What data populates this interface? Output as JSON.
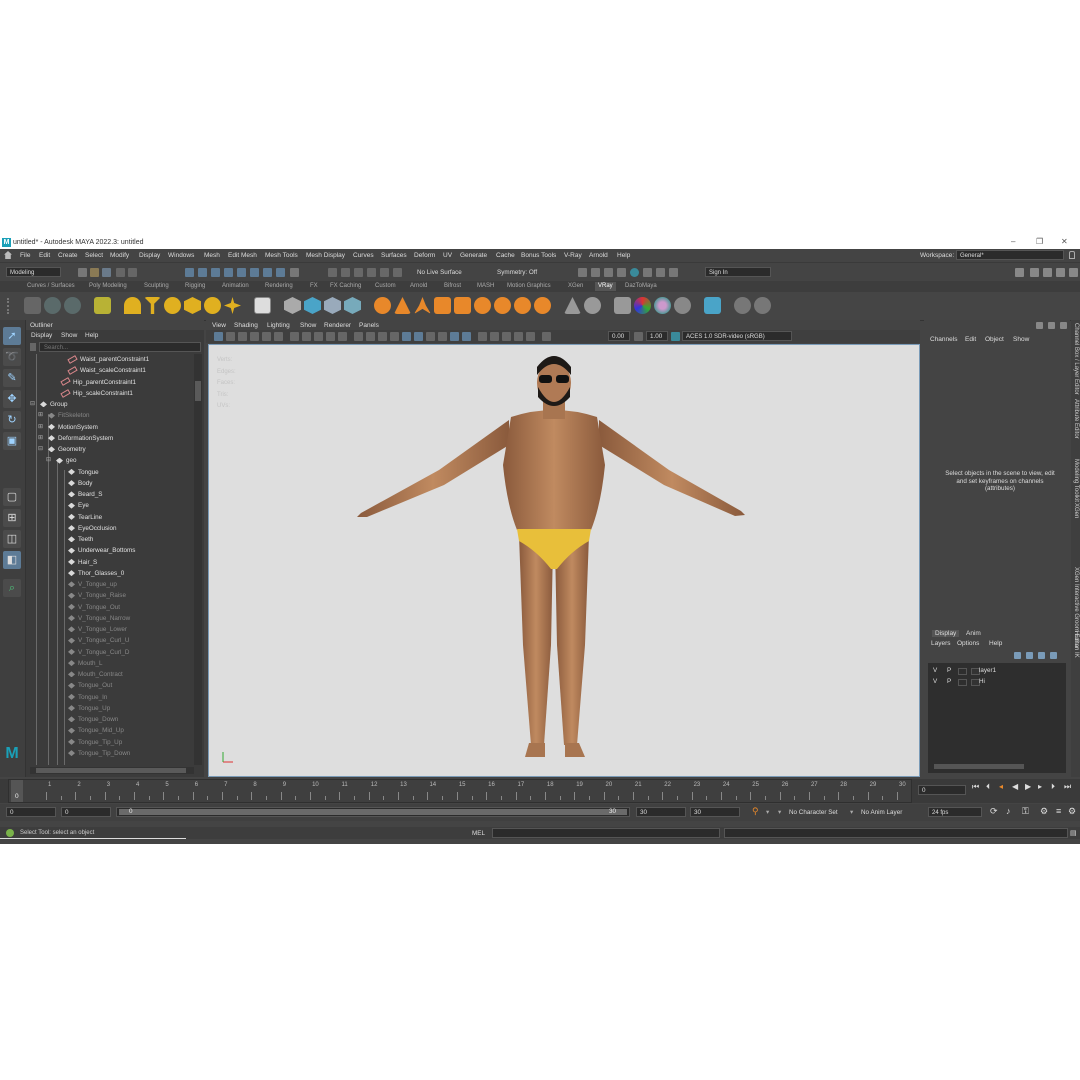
{
  "window": {
    "title": "untitled* - Autodesk MAYA 2022.3: untitled",
    "controls": [
      "–",
      "❐",
      "✕"
    ]
  },
  "menubar": {
    "items": [
      "File",
      "Edit",
      "Create",
      "Select",
      "Modify",
      "Display",
      "Windows",
      "Mesh",
      "Edit Mesh",
      "Mesh Tools",
      "Mesh Display",
      "Curves",
      "Surfaces",
      "Deform",
      "UV",
      "Generate",
      "Cache",
      "Bonus Tools",
      "V-Ray",
      "Arnold",
      "Help"
    ],
    "workspace_label": "Workspace:",
    "workspace_value": "General*"
  },
  "statusline": {
    "mode": "Modeling",
    "live_surface": "No Live Surface",
    "symmetry": "Symmetry: Off",
    "sign_in": "Sign In"
  },
  "shelf": {
    "tabs": [
      "Curves / Surfaces",
      "Poly Modeling",
      "Sculpting",
      "Rigging",
      "Animation",
      "Rendering",
      "FX",
      "FX Caching",
      "Custom",
      "Arnold",
      "Bifrost",
      "MASH",
      "Motion Graphics",
      "XGen",
      "VRay",
      "DazToMaya"
    ],
    "active_tab": "VRay"
  },
  "outliner": {
    "title": "Outliner",
    "menu": [
      "Display",
      "Show",
      "Help"
    ],
    "search_placeholder": "Search...",
    "rows": [
      {
        "label": "Waist_parentConstraint1",
        "icon": "constraint-icon",
        "dim": false
      },
      {
        "label": "Waist_scaleConstraint1",
        "icon": "constraint-icon",
        "dim": false
      },
      {
        "label": "Hip_parentConstraint1",
        "icon": "constraint-icon",
        "dim": false
      },
      {
        "label": "Hip_scaleConstraint1",
        "icon": "constraint-icon",
        "dim": false
      },
      {
        "label": "Group",
        "icon": "group-icon",
        "dim": false
      },
      {
        "label": "FitSkeleton",
        "icon": "group-icon",
        "dim": true
      },
      {
        "label": "MotionSystem",
        "icon": "group-icon",
        "dim": false
      },
      {
        "label": "DeformationSystem",
        "icon": "group-icon",
        "dim": false
      },
      {
        "label": "Geometry",
        "icon": "group-icon",
        "dim": false
      },
      {
        "label": "geo",
        "icon": "group-icon",
        "dim": false
      },
      {
        "label": "Tongue",
        "icon": "mesh-icon",
        "dim": false
      },
      {
        "label": "Body",
        "icon": "mesh-icon",
        "dim": false
      },
      {
        "label": "Beard_S",
        "icon": "mesh-icon",
        "dim": false
      },
      {
        "label": "Eye",
        "icon": "mesh-icon",
        "dim": false
      },
      {
        "label": "TearLine",
        "icon": "mesh-icon",
        "dim": false
      },
      {
        "label": "EyeOcclusion",
        "icon": "mesh-icon",
        "dim": false
      },
      {
        "label": "Teeth",
        "icon": "mesh-icon",
        "dim": false
      },
      {
        "label": "Underwear_Bottoms",
        "icon": "mesh-icon",
        "dim": false
      },
      {
        "label": "Hair_S",
        "icon": "mesh-icon",
        "dim": false
      },
      {
        "label": "Thor_Glasses_0",
        "icon": "mesh-icon",
        "dim": false
      },
      {
        "label": "V_Tongue_up",
        "icon": "mesh-icon",
        "dim": true
      },
      {
        "label": "V_Tongue_Raise",
        "icon": "mesh-icon",
        "dim": true
      },
      {
        "label": "V_Tongue_Out",
        "icon": "mesh-icon",
        "dim": true
      },
      {
        "label": "V_Tongue_Narrow",
        "icon": "mesh-icon",
        "dim": true
      },
      {
        "label": "V_Tongue_Lower",
        "icon": "mesh-icon",
        "dim": true
      },
      {
        "label": "V_Tongue_Curl_U",
        "icon": "mesh-icon",
        "dim": true
      },
      {
        "label": "V_Tongue_Curl_D",
        "icon": "mesh-icon",
        "dim": true
      },
      {
        "label": "Mouth_L",
        "icon": "mesh-icon",
        "dim": true
      },
      {
        "label": "Mouth_Contract",
        "icon": "mesh-icon",
        "dim": true
      },
      {
        "label": "Tongue_Out",
        "icon": "mesh-icon",
        "dim": true
      },
      {
        "label": "Tongue_In",
        "icon": "mesh-icon",
        "dim": true
      },
      {
        "label": "Tongue_Up",
        "icon": "mesh-icon",
        "dim": true
      },
      {
        "label": "Tongue_Down",
        "icon": "mesh-icon",
        "dim": true
      },
      {
        "label": "Tongue_Mid_Up",
        "icon": "mesh-icon",
        "dim": true
      },
      {
        "label": "Tongue_Tip_Up",
        "icon": "mesh-icon",
        "dim": true
      },
      {
        "label": "Tongue_Tip_Down",
        "icon": "mesh-icon",
        "dim": true
      }
    ]
  },
  "viewport": {
    "menu": [
      "View",
      "Shading",
      "Lighting",
      "Show",
      "Renderer",
      "Panels"
    ],
    "exposure": "0.00",
    "gamma": "1.00",
    "color_space": "ACES 1.0 SDR-video (sRGB)",
    "hud_labels": [
      "Verts:",
      "Edges:",
      "Faces:",
      "Tris:",
      "UVs:"
    ]
  },
  "channelbox": {
    "menu": [
      "Channels",
      "Edit",
      "Object",
      "Show"
    ],
    "message": "Select objects in the scene to view, edit and set keyframes on channels (attributes)"
  },
  "sidetabs": [
    "Channel Box / Layer Editor",
    "Attribute Editor",
    "Modeling Toolkit",
    "XGen",
    "XGen Interactive Groom Editor",
    "Human IK"
  ],
  "layer_editor": {
    "tabs": [
      "Display",
      "Anim"
    ],
    "menu": [
      "Layers",
      "Options",
      "Help"
    ],
    "layers": [
      {
        "v": "V",
        "p": "P",
        "name": "layer1"
      },
      {
        "v": "V",
        "p": "P",
        "name": "Hi"
      }
    ]
  },
  "timeline": {
    "ticks": [
      "1",
      "2",
      "3",
      "4",
      "5",
      "6",
      "7",
      "8",
      "9",
      "10",
      "11",
      "12",
      "13",
      "14",
      "15",
      "16",
      "17",
      "18",
      "19",
      "20",
      "21",
      "22",
      "23",
      "24",
      "25",
      "26",
      "27",
      "28",
      "29",
      "30"
    ],
    "current_frame": "0",
    "frame_field": "0"
  },
  "range": {
    "start": "0",
    "anim_start": "0",
    "slider_start": "0",
    "slider_end": "30",
    "end": "30",
    "anim_end": "30",
    "character_set": "No Character Set",
    "anim_layer": "No Anim Layer",
    "fps": "24 fps"
  },
  "helpline": {
    "text": "Select Tool: select an object",
    "mel": "MEL"
  },
  "colors": {
    "accent": "#5d7b96",
    "maya_logo": "#1aa0b8"
  }
}
